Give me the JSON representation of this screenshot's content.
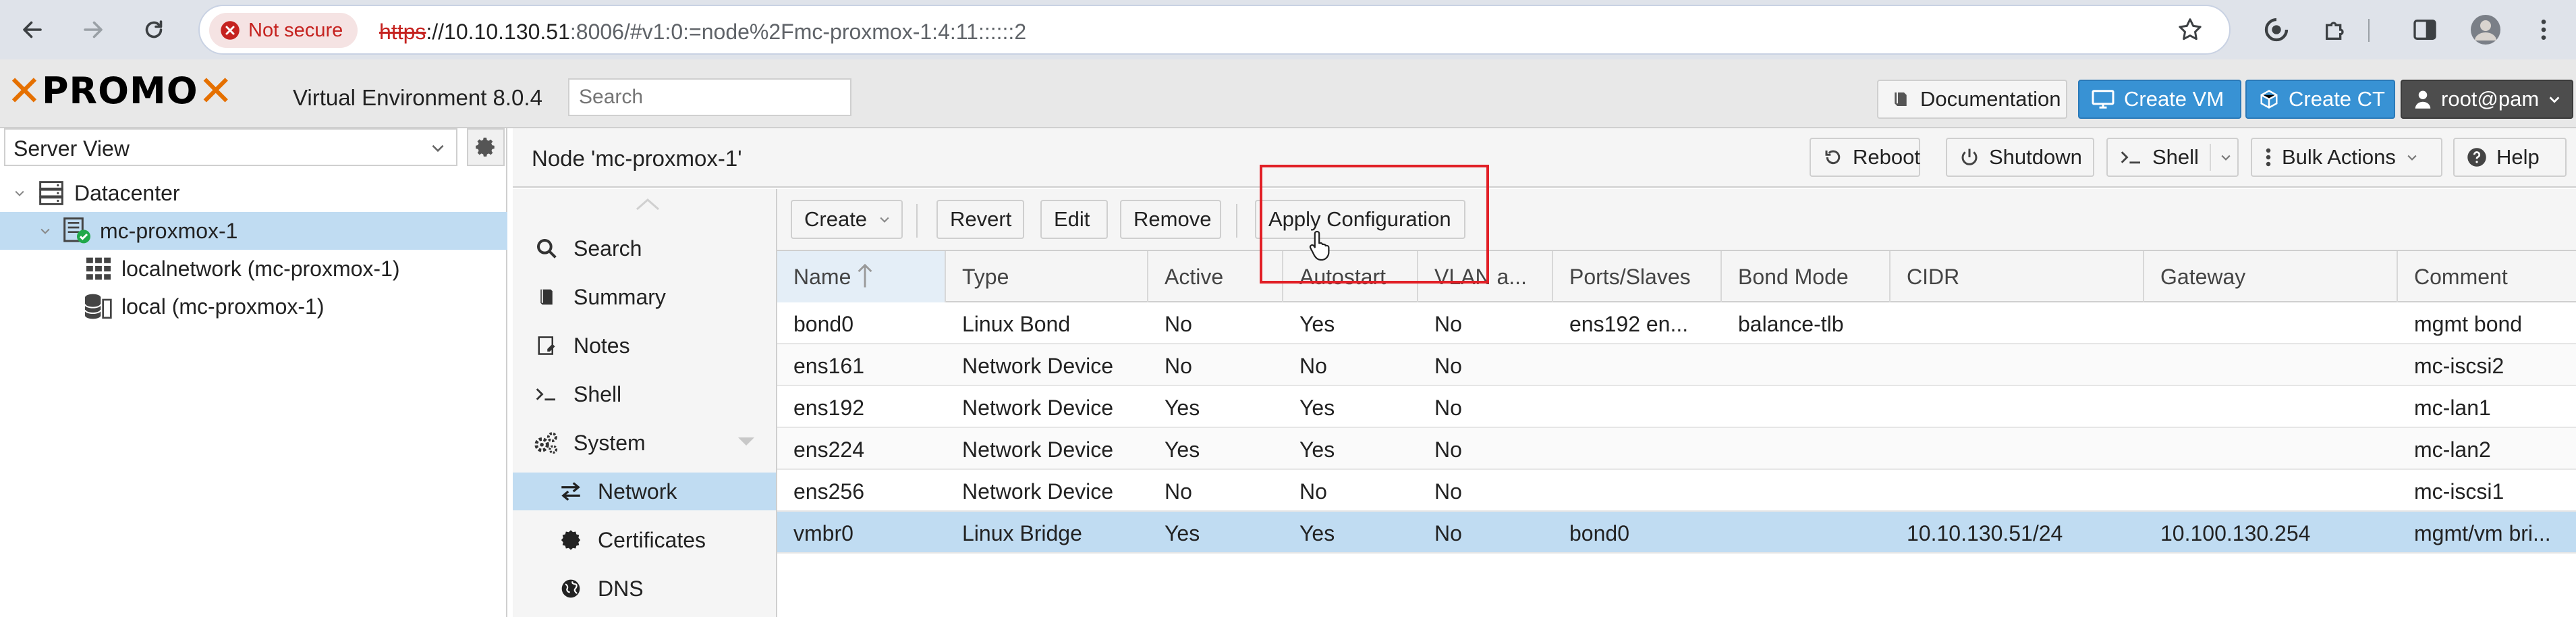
{
  "browser": {
    "security_label": "Not secure",
    "url_scheme": "https",
    "url_host": "://10.10.130.51",
    "url_path": ":8006/#v1:0:=node%2Fmc-proxmox-1:4:11::::::2"
  },
  "header": {
    "brand_word_1": "PRO",
    "brand_word_2": "MO",
    "version": "Virtual Environment 8.0.4",
    "search_placeholder": "Search",
    "documentation": "Documentation",
    "create_vm": "Create VM",
    "create_ct": "Create CT",
    "user": "root@pam"
  },
  "tree": {
    "view": "Server View",
    "items": [
      {
        "label": "Datacenter"
      },
      {
        "label": "mc-proxmox-1"
      },
      {
        "label": "localnetwork (mc-proxmox-1)"
      },
      {
        "label": "local (mc-proxmox-1)"
      }
    ]
  },
  "node": {
    "title": "Node 'mc-proxmox-1'",
    "reboot": "Reboot",
    "shutdown": "Shutdown",
    "shell": "Shell",
    "bulk_actions": "Bulk Actions",
    "help": "Help"
  },
  "nav": {
    "items": [
      {
        "label": "Search"
      },
      {
        "label": "Summary"
      },
      {
        "label": "Notes"
      },
      {
        "label": "Shell"
      },
      {
        "label": "System"
      },
      {
        "label": "Network"
      },
      {
        "label": "Certificates"
      },
      {
        "label": "DNS"
      }
    ]
  },
  "toolbar": {
    "create": "Create",
    "revert": "Revert",
    "edit": "Edit",
    "remove": "Remove",
    "apply": "Apply Configuration"
  },
  "grid": {
    "columns": [
      "Name",
      "Type",
      "Active",
      "Autostart",
      "VLAN a...",
      "Ports/Slaves",
      "Bond Mode",
      "CIDR",
      "Gateway",
      "Comment"
    ],
    "rows": [
      [
        "bond0",
        "Linux Bond",
        "No",
        "Yes",
        "No",
        "ens192 en...",
        "balance-tlb",
        "",
        "",
        "mgmt bond"
      ],
      [
        "ens161",
        "Network Device",
        "No",
        "No",
        "No",
        "",
        "",
        "",
        "",
        "mc-iscsi2"
      ],
      [
        "ens192",
        "Network Device",
        "Yes",
        "Yes",
        "No",
        "",
        "",
        "",
        "",
        "mc-lan1"
      ],
      [
        "ens224",
        "Network Device",
        "Yes",
        "Yes",
        "No",
        "",
        "",
        "",
        "",
        "mc-lan2"
      ],
      [
        "ens256",
        "Network Device",
        "No",
        "No",
        "No",
        "",
        "",
        "",
        "",
        "mc-iscsi1"
      ],
      [
        "vmbr0",
        "Linux Bridge",
        "Yes",
        "Yes",
        "No",
        "bond0",
        "",
        "10.10.130.51/24",
        "10.100.130.254",
        "mgmt/vm bri..."
      ]
    ]
  },
  "colors": {
    "accent_orange": "#e57000",
    "selection_blue": "#c0dcf2",
    "button_blue": "#3892d4",
    "highlight_red": "#e11f26"
  }
}
